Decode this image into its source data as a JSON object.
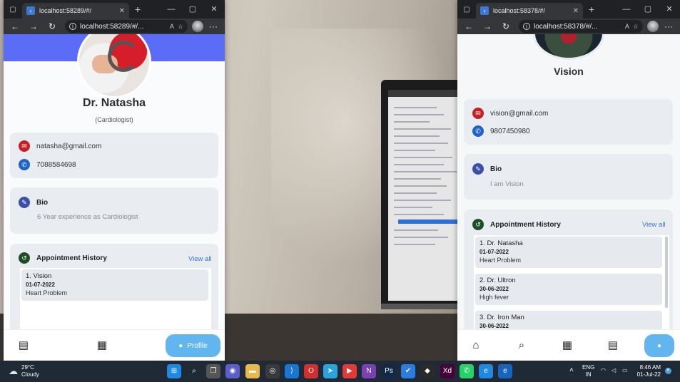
{
  "left_window": {
    "tab_title": "localhost:58289/#/",
    "url": "localhost:58289/#/...",
    "doctor": {
      "name": "Dr. Natasha",
      "specialty": "(Cardiologist)",
      "email": "natasha@gmail.com",
      "phone": "7088584698",
      "bio_title": "Bio",
      "bio_text": "6 Year experience as Cardiologist"
    },
    "history": {
      "title": "Appointment History",
      "view_all": "View all",
      "items": [
        {
          "name": "1. Vision",
          "date": "01-07-2022",
          "reason": "Heart Problem"
        }
      ]
    },
    "nav": {
      "profile_label": "Profile"
    }
  },
  "right_window": {
    "tab_title": "localhost:58378/#/",
    "url": "localhost:58378/#/...",
    "patient": {
      "name": "Vision",
      "email": "vision@gmail.com",
      "phone": "9807450980",
      "bio_title": "Bio",
      "bio_text": "I am Vision"
    },
    "history": {
      "title": "Appointment History",
      "view_all": "View all",
      "items": [
        {
          "name": "1. Dr. Natasha",
          "date": "01-07-2022",
          "reason": "Heart Problem"
        },
        {
          "name": "2. Dr. Ultron",
          "date": "30-06-2022",
          "reason": "High fever"
        },
        {
          "name": "3. Dr. Iron Man",
          "date": "30-06-2022",
          "reason": ""
        }
      ]
    }
  },
  "taskbar": {
    "weather_temp": "29°C",
    "weather_desc": "Cloudy",
    "lang_line1": "ENG",
    "lang_line2": "IN",
    "time": "8:46 AM",
    "date": "01-Jul-22",
    "notification_count": "6"
  },
  "colors": {
    "cover": "#5b6cf7",
    "profile_pill": "#62b6f0",
    "link": "#2f78d6",
    "email_icon": "#c41f24",
    "phone_icon": "#1f63c6"
  }
}
